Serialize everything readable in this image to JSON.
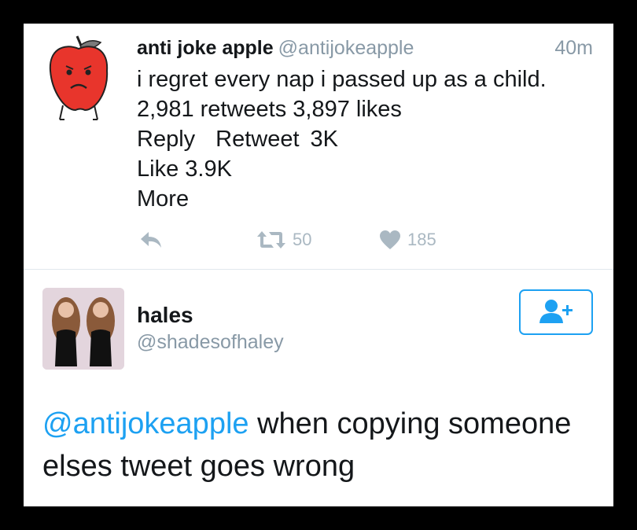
{
  "tweet": {
    "author_name": "anti joke apple",
    "author_handle": "@antijokeapple",
    "time": "40m",
    "text": "i regret every nap i passed up as a child.",
    "stats": "2,981 retweets 3,897 likes",
    "reply_label": "Reply",
    "retweet_label": "Retweet",
    "retweet_count_label": "3K",
    "like_label": "Like 3.9K",
    "more_label": "More",
    "retweet_count": "50",
    "like_count": "185",
    "avatar_icon": "sad-apple-icon"
  },
  "reply": {
    "author_name": "hales",
    "author_handle": "@shadesofhaley",
    "mention": "@antijokeapple",
    "text": " when copying someone elses tweet goes wrong",
    "follow_icon": "add-user-icon"
  },
  "colors": {
    "accent": "#1da1f2",
    "muted": "#8899a6",
    "icon_gray": "#aab8c2",
    "text": "#14171a",
    "apple_red": "#e8352c"
  }
}
